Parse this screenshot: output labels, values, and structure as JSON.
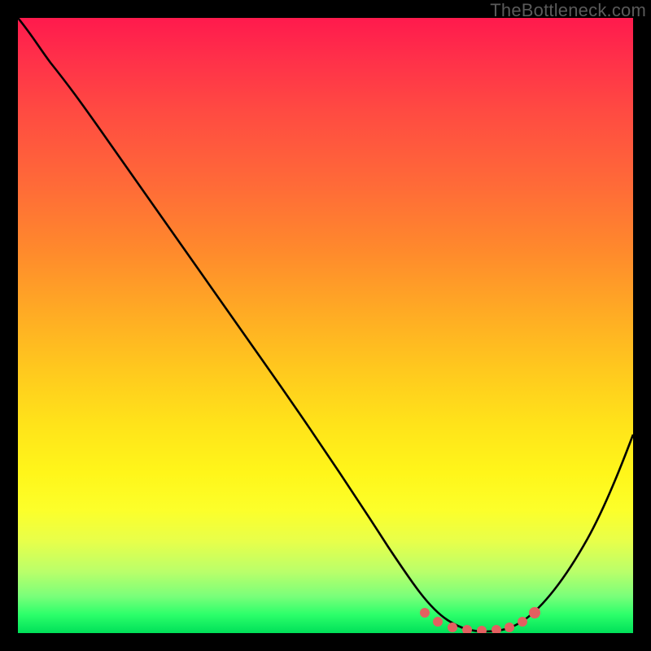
{
  "watermark": {
    "text": "TheBottleneck.com"
  },
  "chart_data": {
    "type": "line",
    "title": "",
    "xlabel": "",
    "ylabel": "",
    "xlim": [
      0,
      100
    ],
    "ylim": [
      0,
      100
    ],
    "grid": false,
    "legend": false,
    "series": [
      {
        "name": "curve",
        "color": "#000000",
        "x": [
          0,
          3,
          6,
          10,
          15,
          20,
          25,
          30,
          35,
          40,
          45,
          50,
          55,
          60,
          64,
          67,
          70,
          73,
          76,
          79,
          82,
          85,
          88,
          92,
          96,
          100
        ],
        "y": [
          100,
          98,
          96,
          93,
          87,
          80,
          73,
          66,
          59,
          52,
          45,
          38,
          31,
          23,
          15,
          9,
          4,
          1,
          0,
          0,
          1,
          3,
          7,
          14,
          24,
          36
        ]
      },
      {
        "name": "highlight-dots",
        "color": "#e55a5a",
        "type": "scatter",
        "x": [
          67,
          69,
          71,
          73,
          75,
          77,
          79,
          81,
          83
        ],
        "y": [
          3.4,
          2.0,
          1.2,
          0.7,
          0.5,
          0.5,
          0.7,
          1.3,
          2.5
        ]
      }
    ],
    "background_gradient": {
      "direction": "vertical",
      "stops": [
        {
          "pos": 0.0,
          "color": "#ff1a4d"
        },
        {
          "pos": 0.3,
          "color": "#ff7a30"
        },
        {
          "pos": 0.6,
          "color": "#ffd81c"
        },
        {
          "pos": 0.8,
          "color": "#fcff2a"
        },
        {
          "pos": 0.95,
          "color": "#7aff7a"
        },
        {
          "pos": 1.0,
          "color": "#00e059"
        }
      ]
    }
  }
}
